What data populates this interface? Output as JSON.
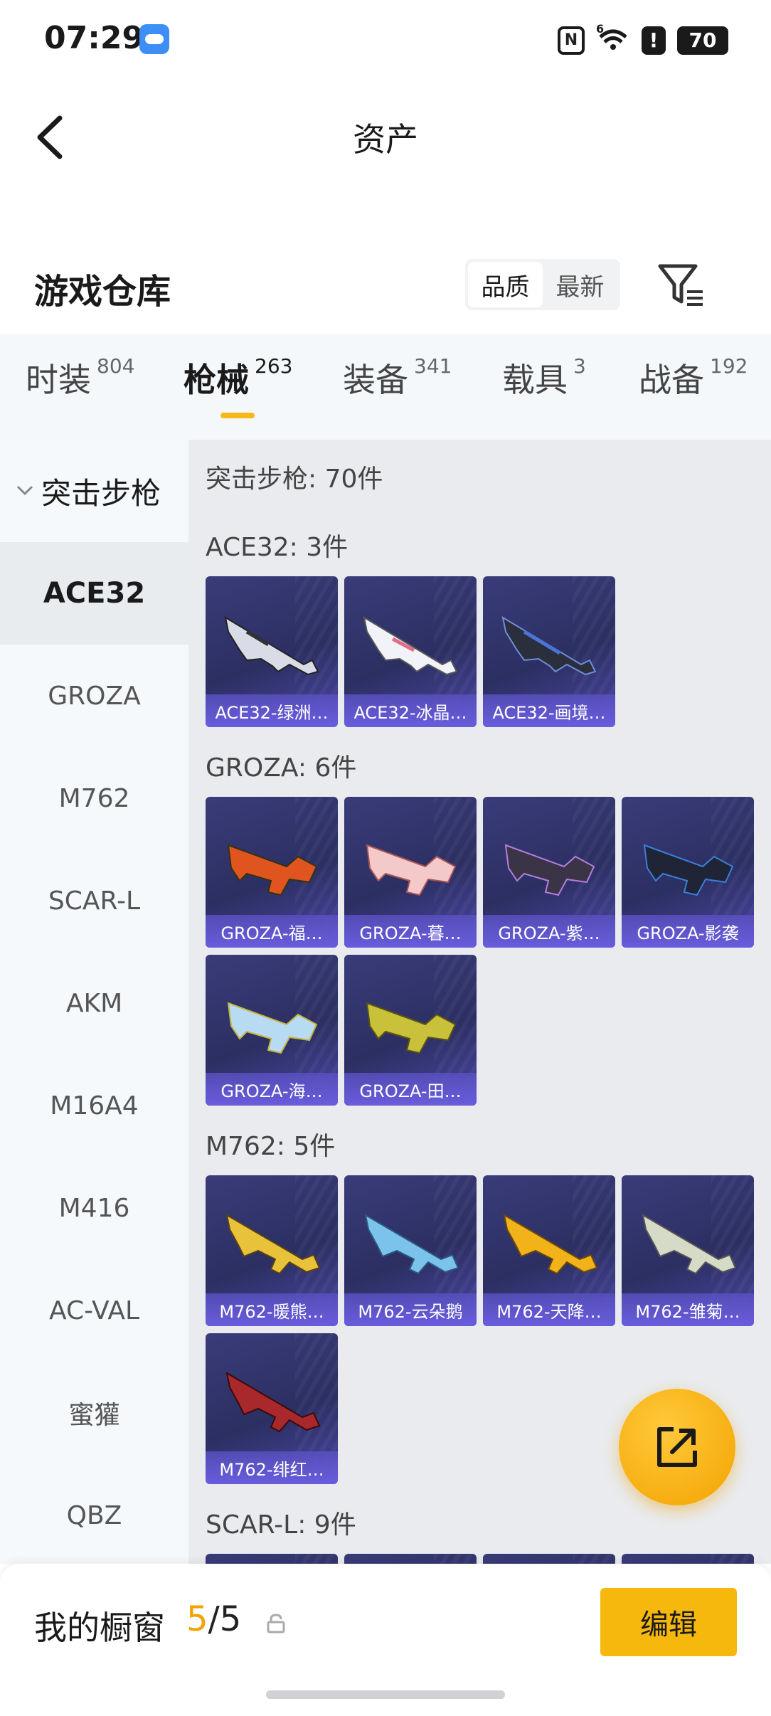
{
  "status_bar": {
    "time": "07:29",
    "nfc": "N",
    "network": "6",
    "battery": "70"
  },
  "header": {
    "title": "资产"
  },
  "warehouse": {
    "title": "游戏仓库",
    "sort_quality": "品质",
    "sort_latest": "最新"
  },
  "tabs": [
    {
      "label": "时装",
      "count": "804"
    },
    {
      "label": "枪械",
      "count": "263"
    },
    {
      "label": "装备",
      "count": "341"
    },
    {
      "label": "载具",
      "count": "3"
    },
    {
      "label": "战备",
      "count": "192"
    }
  ],
  "sidebar": {
    "category": "突击步枪",
    "items": [
      "ACE32",
      "GROZA",
      "M762",
      "SCAR-L",
      "AKM",
      "M16A4",
      "M416",
      "AC-VAL",
      "蜜獾",
      "QBZ"
    ]
  },
  "main": {
    "category_title": "突击步枪: 70件",
    "sections": [
      {
        "title": "ACE32: 3件",
        "items": [
          "ACE32-绿洲…",
          "ACE32-冰晶…",
          "ACE32-画境…"
        ]
      },
      {
        "title": "GROZA: 6件",
        "items": [
          "GROZA-福…",
          "GROZA-暮…",
          "GROZA-紫…",
          "GROZA-影袭",
          "GROZA-海…",
          "GROZA-田…"
        ]
      },
      {
        "title": "M762: 5件",
        "items": [
          "M762-暖熊…",
          "M762-云朵鹅",
          "M762-天降…",
          "M762-雏菊…",
          "M762-绯红…"
        ]
      },
      {
        "title": "SCAR-L: 9件",
        "items": []
      }
    ]
  },
  "bottom_bar": {
    "showcase_label": "我的橱窗",
    "showcase_current": "5",
    "showcase_total": "/5",
    "edit_label": "编辑"
  },
  "colors": {
    "accent": "#f7b80e",
    "card_bg": "#2c2f62",
    "card_caption": "#685cdc"
  }
}
